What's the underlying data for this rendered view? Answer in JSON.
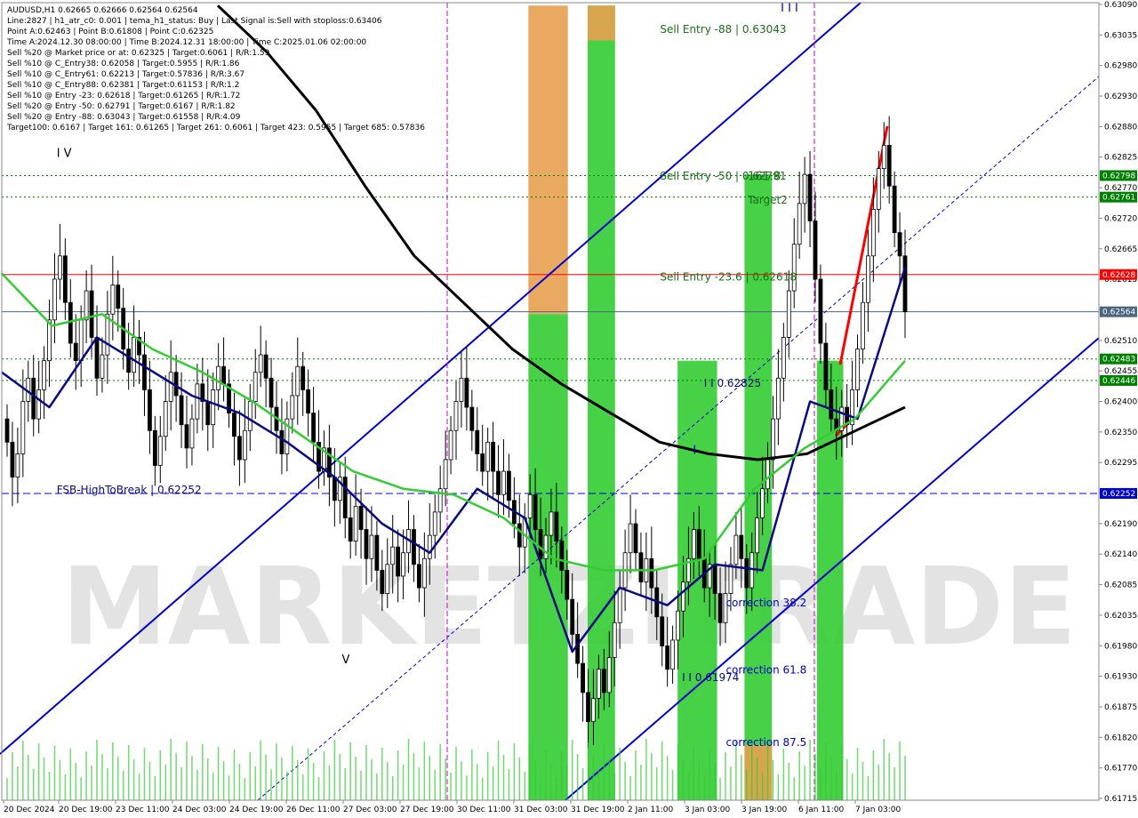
{
  "info_panel": {
    "lines": [
      "AUDUSD,H1  0.62665 0.62666 0.62564 0.62564",
      "Line:2827  |  h1_atr_c0: 0.001  |  tema_h1_status: Buy  |  Last Signal is:Sell with stoploss:0.63406",
      "Point A:0.62463  |  Point B:0.61808  |  Point C:0.62325",
      "Time A:2024.12.30 08:00:00  |  Time B:2024.12.31 18:00:00  |  Time C:2025.01.06 02:00:00",
      "Sell %20 @ Market price or at: 0.62325  |  Target:0.6061  |  R/R:1.59",
      "Sell %10 @ C_Entry38: 0.62058  |  Target:0.5955  |  R/R:1.86",
      "Sell %10 @ C_Entry61: 0.62213  |  Target:0.57836  |  R/R:3.67",
      "Sell %10 @ C_Entry88: 0.62381  |  Target:0.61153  |  R/R:1.2",
      "Sell %10 @ Entry -23: 0.62618  |  Target:0.61265  |  R/R:1.72",
      "Sell %20 @ Entry -50: 0.62791  |  Target:0.6167  |  R/R:1.82",
      "Sell %20 @ Entry -88: 0.63043  |  Target:0.61558  |  R/R:4.09",
      "Target100: 0.6167  |  Target 161: 0.61265  |  Target 261: 0.6061  |  Target 423: 0.5955  |  Target 685: 0.57836"
    ]
  },
  "watermark": "MARKETZITRADE",
  "colors": {
    "background": "#ffffff",
    "bull": "#000000",
    "bear": "#000000",
    "channel": "#0000cc",
    "ma_black": "#000000",
    "ma_navy": "#0a0a80",
    "ma_green": "#33cc33",
    "red_line": "#ff0000",
    "green_dotted": "#008000",
    "blue_dashed": "#0000cc",
    "orange_dashed": "#ff4500",
    "zone_orange": "#e8a050",
    "zone_green": "#33cc33"
  },
  "chart_data": {
    "type": "candlestick",
    "symbol": "AUDUSD",
    "timeframe": "H1",
    "ylim": [
      0.61725,
      0.63095
    ],
    "y_ticks": [
      "0.63090",
      "0.63035",
      "0.62980",
      "0.62930",
      "0.62880",
      "0.62825",
      "0.62770",
      "0.62720",
      "0.62665",
      "0.62615",
      "0.62560",
      "0.62510",
      "0.62455",
      "0.62400",
      "0.62350",
      "0.62295",
      "0.62245",
      "0.62190",
      "0.62140",
      "0.62085",
      "0.62035",
      "0.61980",
      "0.61930",
      "0.61875",
      "0.61820",
      "0.61770",
      "0.61715"
    ],
    "x_ticks": [
      "20 Dec 2024",
      "20 Dec 19:00",
      "23 Dec 11:00",
      "24 Dec 03:00",
      "24 Dec 19:00",
      "26 Dec 11:00",
      "27 Dec 03:00",
      "27 Dec 19:00",
      "30 Dec 11:00",
      "31 Dec 03:00",
      "31 Dec 19:00",
      "2 Jan 11:00",
      "3 Jan 03:00",
      "3 Jan 19:00",
      "6 Jan 11:00",
      "7 Jan 03:00"
    ],
    "ohlc_start": 0.6238,
    "ohlc_path": [
      0.6234,
      0.6228,
      0.6232,
      0.6241,
      0.6245,
      0.6238,
      0.6243,
      0.6248,
      0.6255,
      0.6262,
      0.6266,
      0.6258,
      0.6251,
      0.6248,
      0.6255,
      0.626,
      0.6252,
      0.6245,
      0.6249,
      0.6256,
      0.6261,
      0.6257,
      0.625,
      0.6246,
      0.6252,
      0.6249,
      0.6243,
      0.6236,
      0.623,
      0.6235,
      0.6241,
      0.6246,
      0.6242,
      0.6237,
      0.6233,
      0.6238,
      0.6244,
      0.6241,
      0.6237,
      0.6243,
      0.6247,
      0.6244,
      0.6239,
      0.6235,
      0.6231,
      0.6236,
      0.6241,
      0.6246,
      0.6249,
      0.6245,
      0.624,
      0.6236,
      0.6232,
      0.6238,
      0.6242,
      0.6247,
      0.6243,
      0.6239,
      0.6234,
      0.6229,
      0.6233,
      0.6228,
      0.6224,
      0.6228,
      0.6221,
      0.6217,
      0.6223,
      0.6219,
      0.6214,
      0.6218,
      0.6212,
      0.6208,
      0.6213,
      0.6216,
      0.6211,
      0.6215,
      0.6219,
      0.6213,
      0.6209,
      0.6214,
      0.6218,
      0.6222,
      0.6226,
      0.6231,
      0.6236,
      0.6241,
      0.6245,
      0.624,
      0.6236,
      0.6232,
      0.6229,
      0.6234,
      0.6229,
      0.6225,
      0.6229,
      0.6224,
      0.622,
      0.6216,
      0.6221,
      0.6225,
      0.6219,
      0.6214,
      0.6218,
      0.6222,
      0.6217,
      0.6212,
      0.6207,
      0.6201,
      0.6196,
      0.6191,
      0.6186,
      0.619,
      0.6195,
      0.6191,
      0.6197,
      0.6203,
      0.6209,
      0.6215,
      0.622,
      0.6215,
      0.621,
      0.6214,
      0.6209,
      0.6204,
      0.6199,
      0.6195,
      0.62,
      0.6205,
      0.621,
      0.6214,
      0.6219,
      0.6214,
      0.6209,
      0.6213,
      0.6208,
      0.6203,
      0.6208,
      0.6213,
      0.6218,
      0.6214,
      0.6209,
      0.6215,
      0.6221,
      0.6226,
      0.6231,
      0.6238,
      0.6245,
      0.6252,
      0.626,
      0.6268,
      0.6275,
      0.628,
      0.6272,
      0.6262,
      0.6251,
      0.6243,
      0.6238,
      0.6236,
      0.624,
      0.6237,
      0.6243,
      0.625,
      0.6258,
      0.6266,
      0.6274,
      0.6281,
      0.6285,
      0.6278,
      0.627,
      0.6266,
      0.62564
    ],
    "horizontal_lines": [
      {
        "value": 0.62798,
        "label": "0.62798",
        "style": "dotted",
        "color": "#008000"
      },
      {
        "value": 0.62761,
        "label": "0.62761",
        "style": "dotted",
        "color": "#008000"
      },
      {
        "value": 0.62628,
        "label": "0.62628",
        "style": "solid",
        "color": "#ff0000"
      },
      {
        "value": 0.62564,
        "label": "0.62564",
        "style": "solid",
        "color": "#4d6680"
      },
      {
        "value": 0.62483,
        "label": "0.62483",
        "style": "dotted",
        "color": "#008000"
      },
      {
        "value": 0.62446,
        "label": "0.62446",
        "style": "dotted",
        "color": "#008000"
      },
      {
        "value": 0.62252,
        "label": "0.62252",
        "style": "dashed",
        "color": "#0000cc"
      }
    ],
    "annotations": [
      {
        "text": "Sell Entry -88 | 0.63043",
        "x": 0.6,
        "y": 0.63043,
        "color": "#1a6e1a"
      },
      {
        "text": "Sell Entry -50 | 0.62791",
        "x": 0.6,
        "y": 0.62791,
        "color": "#1a6e1a"
      },
      {
        "text": "Sell Entry -23.6 | 0.62618",
        "x": 0.6,
        "y": 0.62618,
        "color": "#1a6e1a"
      },
      {
        "text": "161.8",
        "x": 0.68,
        "y": 0.6279,
        "color": "#1a6e1a"
      },
      {
        "text": "Target2",
        "x": 0.68,
        "y": 0.6275,
        "color": "#1a6e1a"
      },
      {
        "text": "I I 0.62825",
        "x": 0.64,
        "y": 0.62435,
        "color": "#0a0a80"
      },
      {
        "text": "I I 0.61974",
        "x": 0.62,
        "y": 0.6193,
        "color": "#0a0a80"
      },
      {
        "text": "correction 38.2",
        "x": 0.66,
        "y": 0.62058,
        "color": "#0000cc"
      },
      {
        "text": "correction 61.8",
        "x": 0.66,
        "y": 0.61943,
        "color": "#0000cc"
      },
      {
        "text": "correction 87.5",
        "x": 0.66,
        "y": 0.61818,
        "color": "#0000cc"
      },
      {
        "text": "FSB-HighToBreak | 0.62252",
        "x": 0.05,
        "y": 0.62252,
        "color": "#0a0a80"
      },
      {
        "text": "I V",
        "x": 0.05,
        "y": 0.6283,
        "color": "#000000"
      },
      {
        "text": "V",
        "x": 0.31,
        "y": 0.6196,
        "color": "#000000"
      },
      {
        "text": "I",
        "x": 0.63,
        "y": 0.6232,
        "color": "#0000cc"
      },
      {
        "text": "I I I",
        "x": 0.71,
        "y": 0.6308,
        "color": "#0000cc"
      }
    ],
    "zones": [
      {
        "color": "#e8a050",
        "x": [
          0.48,
          0.516
        ],
        "y": [
          0.6256,
          0.6309
        ]
      },
      {
        "color": "#33cc33",
        "x": [
          0.48,
          0.516
        ],
        "y": [
          0.6172,
          0.6256
        ]
      },
      {
        "color": "#33cc33",
        "x": [
          0.534,
          0.559
        ],
        "y": [
          0.6172,
          0.6309
        ]
      },
      {
        "color": "#e8a050",
        "x": [
          0.534,
          0.559
        ],
        "y": [
          0.6303,
          0.6309
        ]
      },
      {
        "color": "#33cc33",
        "x": [
          0.616,
          0.652
        ],
        "y": [
          0.6172,
          0.6248
        ]
      },
      {
        "color": "#33cc33",
        "x": [
          0.677,
          0.702
        ],
        "y": [
          0.6172,
          0.628
        ]
      },
      {
        "color": "#e8a050",
        "x": [
          0.677,
          0.702
        ],
        "y": [
          0.6172,
          0.6182
        ]
      },
      {
        "color": "#33cc33",
        "x": [
          0.743,
          0.767
        ],
        "y": [
          0.6172,
          0.6248
        ]
      }
    ],
    "ma_black_values": [
      0.6309,
      0.6301,
      0.6291,
      0.6278,
      0.6266,
      0.6258,
      0.625,
      0.6244,
      0.6239,
      0.6234,
      0.6232,
      0.6231,
      0.6232,
      0.6236,
      0.624
    ],
    "ma_navy_values": [
      0.6246,
      0.624,
      0.6252,
      0.6247,
      0.6242,
      0.6239,
      0.6234,
      0.6228,
      0.622,
      0.6215,
      0.6226,
      0.6221,
      0.6198,
      0.6209,
      0.6206,
      0.6213,
      0.6212,
      0.6241,
      0.6238,
      0.6264
    ],
    "ma_green_values": [
      0.6263,
      0.6254,
      0.6256,
      0.625,
      0.6246,
      0.6241,
      0.6235,
      0.6229,
      0.6226,
      0.6225,
      0.6221,
      0.6214,
      0.6212,
      0.6212,
      0.6214,
      0.6226,
      0.6233,
      0.6238,
      0.6248
    ]
  }
}
